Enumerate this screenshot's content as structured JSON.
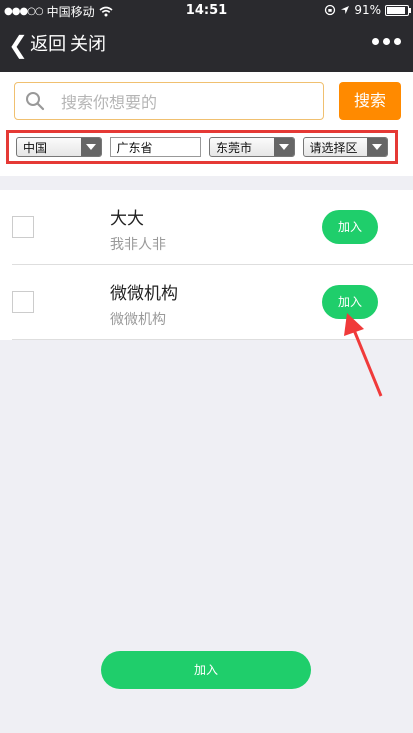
{
  "status_bar": {
    "carrier": "中国移动",
    "time": "14:51",
    "battery": "91%"
  },
  "nav": {
    "back_label": "返回",
    "close_label": "关闭"
  },
  "search": {
    "placeholder": "搜索你想要的",
    "button_label": "搜索"
  },
  "region": {
    "country": "中国",
    "province": "广东省",
    "city": "东莞市",
    "district": "请选择区"
  },
  "items": [
    {
      "name": "大大",
      "desc": "我非人非",
      "join_label": "加入"
    },
    {
      "name": "微微机构",
      "desc": "微微机构",
      "join_label": "加入"
    }
  ],
  "footer": {
    "join_all_label": "加入"
  },
  "colors": {
    "accent_green": "#1fce6b",
    "search_orange": "#ff8a00",
    "highlight_red": "#e53935",
    "nav_dark": "#2a2a2e"
  }
}
